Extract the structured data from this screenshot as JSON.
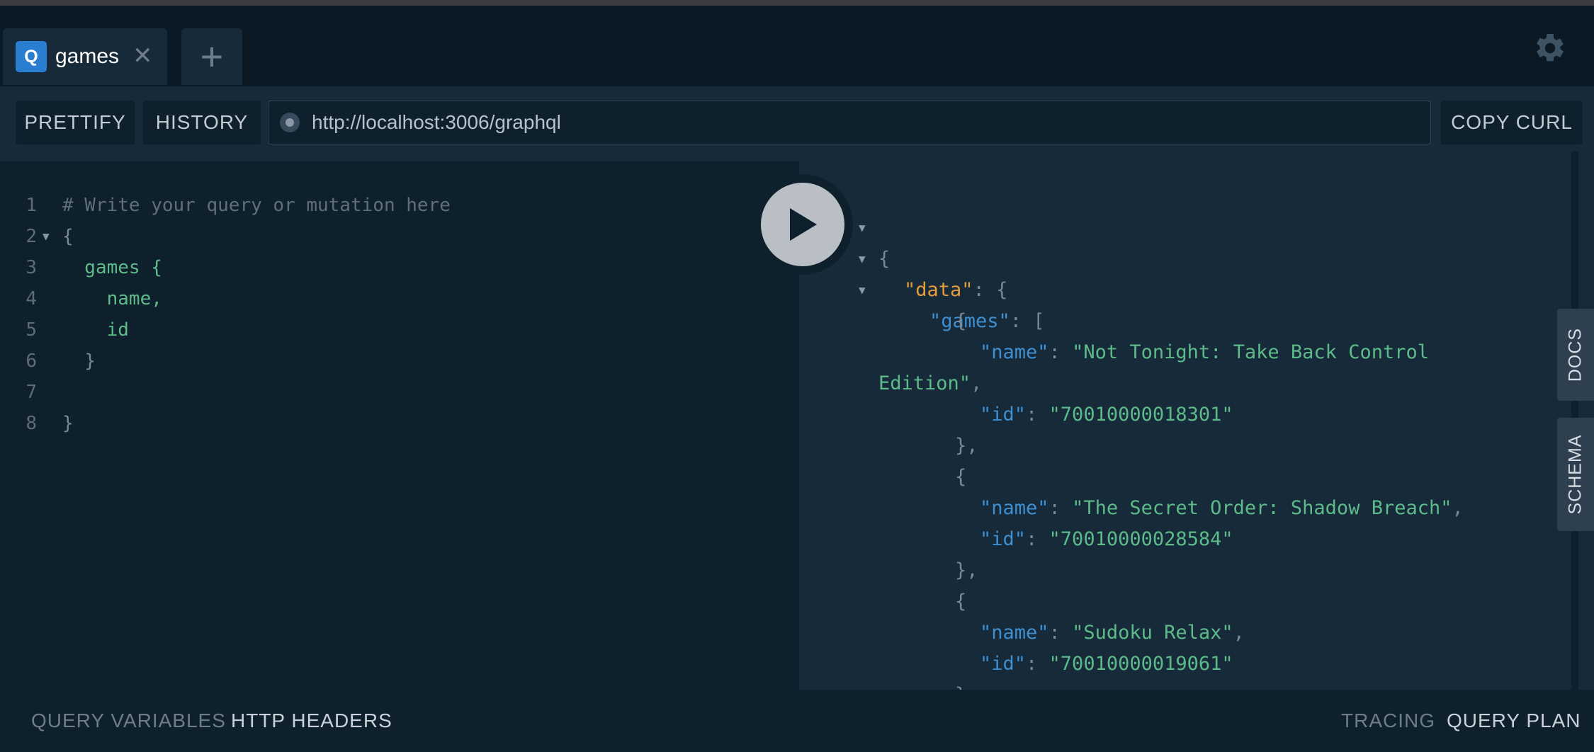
{
  "tabs": [
    {
      "badge": "Q",
      "label": "games",
      "close": "✕"
    }
  ],
  "tab_add_label": "+",
  "toolbar": {
    "prettify": "PRETTIFY",
    "history": "HISTORY",
    "endpoint_url": "http://localhost:3006/graphql",
    "copy_curl": "COPY CURL"
  },
  "editor": {
    "lines": [
      {
        "num": "1",
        "text": "# Write your query or mutation here"
      },
      {
        "num": "2",
        "text": "{"
      },
      {
        "num": "3",
        "text": "  games {"
      },
      {
        "num": "4",
        "text": "    name,"
      },
      {
        "num": "5",
        "text": "    id"
      },
      {
        "num": "6",
        "text": "  }"
      },
      {
        "num": "7",
        "text": ""
      },
      {
        "num": "8",
        "text": "}"
      }
    ]
  },
  "result": {
    "open_brace": "{",
    "data_key": "\"data\"",
    "games_key": "\"games\"",
    "colon": ": ",
    "open_bracket": "[",
    "name_key": "\"name\"",
    "id_key": "\"id\"",
    "items": [
      {
        "name": "\"Not Tonight: Take Back Control",
        "name_cont": "Edition\"",
        "id": "\"70010000018301\""
      },
      {
        "name": "\"The Secret Order: Shadow Breach\"",
        "id": "\"70010000028584\""
      },
      {
        "name": "\"Sudoku Relax\"",
        "id": "\"70010000019061\""
      }
    ]
  },
  "side_tabs": {
    "docs": "DOCS",
    "schema": "SCHEMA"
  },
  "bottom": {
    "query_variables": "QUERY VARIABLES",
    "http_headers": "HTTP HEADERS",
    "tracing": "TRACING",
    "query_plan": "QUERY PLAN"
  },
  "colors": {
    "background": "#172a3a",
    "editor_bg": "#0f202d",
    "tabbar_bg": "#0b1924",
    "badge": "#2a7ed2",
    "json_key": "#3f8fd0",
    "json_string": "#5dbb8a",
    "data_key": "#e79d3a"
  }
}
